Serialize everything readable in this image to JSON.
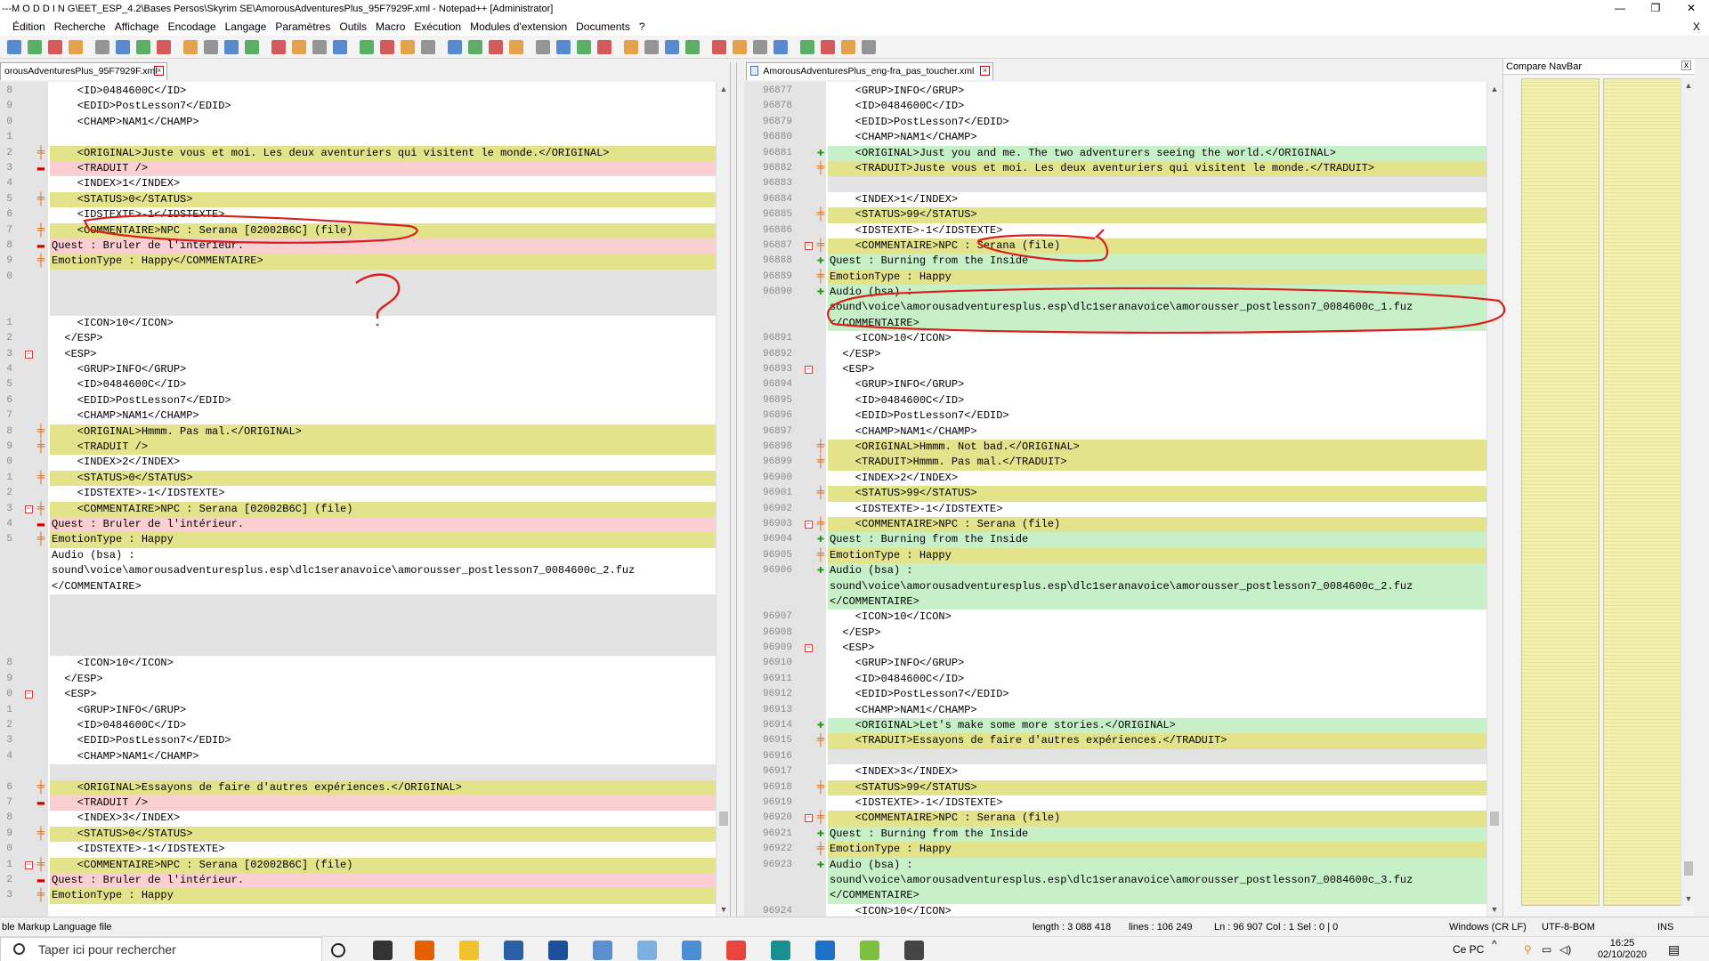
{
  "title_bar": {
    "text": "---M O D D I N G\\EET_ESP_4.2\\Bases Persos\\Skyrim SE\\AmorousAdventuresPlus_95F7929F.xml - Notepad++ [Administrator]",
    "minimize": "—",
    "maximize": "❐",
    "close": "✕"
  },
  "menu": {
    "items": [
      "Édition",
      "Recherche",
      "Affichage",
      "Encodage",
      "Langage",
      "Paramètres",
      "Outils",
      "Macro",
      "Exécution",
      "Modules d'extension",
      "Documents",
      "?"
    ],
    "close_x": "X"
  },
  "toolbar": {
    "icons": [
      "new-icon",
      "open-icon",
      "save-icon",
      "save-all-icon",
      "close-icon",
      "close-all-icon",
      "print-icon",
      "cut-icon",
      "copy-icon",
      "paste-icon",
      "undo-icon",
      "redo-icon",
      "find-icon",
      "replace-icon",
      "zoom-in-icon",
      "zoom-out-icon",
      "sync-v-icon",
      "sync-h-icon",
      "wrap-icon",
      "all-chars-icon",
      "indent-guide-icon",
      "udl-icon",
      "doc-map-icon",
      "function-list-icon",
      "folder-workspace-icon",
      "monitor-icon",
      "record-icon",
      "stop-icon",
      "play-icon",
      "play-multi-icon",
      "save-macro-icon",
      "compare-icon",
      "clear-compare-icon",
      "first-diff-icon",
      "prev-diff-icon",
      "next-diff-icon",
      "last-diff-icon",
      "nav-bar-icon",
      "spellcheck-icon",
      "spell-options-icon"
    ],
    "colors": {
      "blue": "#2b6cc4",
      "green": "#2d9b3a",
      "red": "#c93030",
      "orange": "#e08a1e",
      "gray": "#7a7a7a"
    }
  },
  "tabs": {
    "left": "orousAdventuresPlus_95F7929F.xml",
    "right": "AmorousAdventuresPlus_eng-fra_pas_toucher.xml"
  },
  "left_pane": {
    "lines": [
      {
        "n": "8",
        "cls": "",
        "mk": "",
        "f": "",
        "code": "    <ID>0484600C</ID>"
      },
      {
        "n": "9",
        "cls": "",
        "mk": "",
        "f": "",
        "code": "    <EDID>PostLesson7</EDID>"
      },
      {
        "n": "0",
        "cls": "",
        "mk": "",
        "f": "",
        "code": "    <CHAMP>NAM1</CHAMP>"
      },
      {
        "n": "1",
        "cls": "",
        "mk": "",
        "f": "",
        "code": ""
      },
      {
        "n": "2",
        "cls": "changed",
        "mk": "change",
        "f": "",
        "code": "    <ORIGINAL>Juste vous et moi. Les deux aventuriers qui visitent le monde.</ORIGINAL>"
      },
      {
        "n": "3",
        "cls": "removed",
        "mk": "remove",
        "f": "",
        "code": "    <TRADUIT />"
      },
      {
        "n": "4",
        "cls": "",
        "mk": "",
        "f": "",
        "code": "    <INDEX>1</INDEX>"
      },
      {
        "n": "5",
        "cls": "changed",
        "mk": "change",
        "f": "",
        "code": "    <STATUS>0</STATUS>"
      },
      {
        "n": "6",
        "cls": "",
        "mk": "",
        "f": "",
        "code": "    <IDSTEXTE>-1</IDSTEXTE>"
      },
      {
        "n": "7",
        "cls": "changed",
        "mk": "change",
        "f": "",
        "code": "    <COMMENTAIRE>NPC : Serana [02002B6C] (file)"
      },
      {
        "n": "8",
        "cls": "removed",
        "mk": "remove",
        "f": "",
        "code": "Quest : Bruler de l'intérieur."
      },
      {
        "n": "9",
        "cls": "changed",
        "mk": "change",
        "f": "",
        "code": "EmotionType : Happy</COMMENTAIRE>"
      },
      {
        "n": "0",
        "cls": "blank",
        "mk": "",
        "f": "",
        "code": ""
      },
      {
        "n": "",
        "cls": "blank",
        "mk": "",
        "f": "",
        "code": ""
      },
      {
        "n": "",
        "cls": "blank",
        "mk": "",
        "f": "",
        "code": ""
      },
      {
        "n": "1",
        "cls": "",
        "mk": "",
        "f": "",
        "code": "    <ICON>10</ICON>"
      },
      {
        "n": "2",
        "cls": "",
        "mk": "",
        "f": "",
        "code": "  </ESP>"
      },
      {
        "n": "3",
        "cls": "",
        "mk": "",
        "f": "fold",
        "code": "  <ESP>"
      },
      {
        "n": "4",
        "cls": "",
        "mk": "",
        "f": "",
        "code": "    <GRUP>INFO</GRUP>"
      },
      {
        "n": "5",
        "cls": "",
        "mk": "",
        "f": "",
        "code": "    <ID>0484600C</ID>"
      },
      {
        "n": "6",
        "cls": "",
        "mk": "",
        "f": "",
        "code": "    <EDID>PostLesson7</EDID>"
      },
      {
        "n": "7",
        "cls": "",
        "mk": "",
        "f": "",
        "code": "    <CHAMP>NAM1</CHAMP>"
      },
      {
        "n": "8",
        "cls": "changed",
        "mk": "change",
        "f": "",
        "code": "    <ORIGINAL>Hmmm. Pas mal.</ORIGINAL>"
      },
      {
        "n": "9",
        "cls": "changed",
        "mk": "change",
        "f": "",
        "code": "    <TRADUIT />"
      },
      {
        "n": "0",
        "cls": "",
        "mk": "",
        "f": "",
        "code": "    <INDEX>2</INDEX>"
      },
      {
        "n": "1",
        "cls": "changed",
        "mk": "change",
        "f": "",
        "code": "    <STATUS>0</STATUS>"
      },
      {
        "n": "2",
        "cls": "",
        "mk": "",
        "f": "",
        "code": "    <IDSTEXTE>-1</IDSTEXTE>"
      },
      {
        "n": "3",
        "cls": "changed",
        "mk": "change",
        "f": "fold",
        "code": "    <COMMENTAIRE>NPC : Serana [02002B6C] (file)"
      },
      {
        "n": "4",
        "cls": "removed",
        "mk": "remove",
        "f": "",
        "code": "Quest : Bruler de l'intérieur."
      },
      {
        "n": "5",
        "cls": "changed",
        "mk": "change",
        "f": "",
        "code": "EmotionType : Happy"
      },
      {
        "n": "",
        "cls": "",
        "mk": "",
        "f": "",
        "code": "Audio (bsa) :"
      },
      {
        "n": "",
        "cls": "",
        "mk": "",
        "f": "",
        "code": "sound\\voice\\amorousadventuresplus.esp\\dlc1seranavoice\\amorousser_postlesson7_0084600c_2.fuz"
      },
      {
        "n": "",
        "cls": "",
        "mk": "",
        "f": "",
        "code": "</COMMENTAIRE>"
      },
      {
        "n": "",
        "cls": "blank",
        "mk": "",
        "f": "",
        "code": ""
      },
      {
        "n": "",
        "cls": "blank",
        "mk": "",
        "f": "",
        "code": ""
      },
      {
        "n": "",
        "cls": "blank",
        "mk": "",
        "f": "",
        "code": ""
      },
      {
        "n": "",
        "cls": "blank",
        "mk": "",
        "f": "",
        "code": ""
      },
      {
        "n": "8",
        "cls": "",
        "mk": "",
        "f": "",
        "code": "    <ICON>10</ICON>"
      },
      {
        "n": "9",
        "cls": "",
        "mk": "",
        "f": "",
        "code": "  </ESP>"
      },
      {
        "n": "0",
        "cls": "",
        "mk": "",
        "f": "fold",
        "code": "  <ESP>"
      },
      {
        "n": "1",
        "cls": "",
        "mk": "",
        "f": "",
        "code": "    <GRUP>INFO</GRUP>"
      },
      {
        "n": "2",
        "cls": "",
        "mk": "",
        "f": "",
        "code": "    <ID>0484600C</ID>"
      },
      {
        "n": "3",
        "cls": "",
        "mk": "",
        "f": "",
        "code": "    <EDID>PostLesson7</EDID>"
      },
      {
        "n": "4",
        "cls": "",
        "mk": "",
        "f": "",
        "code": "    <CHAMP>NAM1</CHAMP>"
      },
      {
        "n": "",
        "cls": "blank",
        "mk": "",
        "f": "",
        "code": ""
      },
      {
        "n": "6",
        "cls": "changed",
        "mk": "change",
        "f": "",
        "code": "    <ORIGINAL>Essayons de faire d'autres expériences.</ORIGINAL>"
      },
      {
        "n": "7",
        "cls": "removed",
        "mk": "remove",
        "f": "",
        "code": "    <TRADUIT />"
      },
      {
        "n": "8",
        "cls": "",
        "mk": "",
        "f": "",
        "code": "    <INDEX>3</INDEX>"
      },
      {
        "n": "9",
        "cls": "changed",
        "mk": "change",
        "f": "",
        "code": "    <STATUS>0</STATUS>"
      },
      {
        "n": "0",
        "cls": "",
        "mk": "",
        "f": "",
        "code": "    <IDSTEXTE>-1</IDSTEXTE>"
      },
      {
        "n": "1",
        "cls": "changed",
        "mk": "change",
        "f": "fold",
        "code": "    <COMMENTAIRE>NPC : Serana [02002B6C] (file)"
      },
      {
        "n": "2",
        "cls": "removed",
        "mk": "remove",
        "f": "",
        "code": "Quest : Bruler de l'intérieur."
      },
      {
        "n": "3",
        "cls": "changed",
        "mk": "change",
        "f": "",
        "code": "EmotionType : Happy"
      }
    ]
  },
  "right_pane": {
    "lines": [
      {
        "n": "96877",
        "cls": "",
        "mk": "",
        "f": "",
        "code": "    <GRUP>INFO</GRUP>"
      },
      {
        "n": "96878",
        "cls": "",
        "mk": "",
        "f": "",
        "code": "    <ID>0484600C</ID>"
      },
      {
        "n": "96879",
        "cls": "",
        "mk": "",
        "f": "",
        "code": "    <EDID>PostLesson7</EDID>"
      },
      {
        "n": "96880",
        "cls": "",
        "mk": "",
        "f": "",
        "code": "    <CHAMP>NAM1</CHAMP>"
      },
      {
        "n": "96881",
        "cls": "added",
        "mk": "add",
        "f": "",
        "code": "    <ORIGINAL>Just you and me. The two adventurers seeing the world.</ORIGINAL>"
      },
      {
        "n": "96882",
        "cls": "changed",
        "mk": "change",
        "f": "",
        "code": "    <TRADUIT>Juste vous et moi. Les deux aventuriers qui visitent le monde.</TRADUIT>"
      },
      {
        "n": "96883",
        "cls": "blank",
        "mk": "",
        "f": "",
        "code": ""
      },
      {
        "n": "96884",
        "cls": "",
        "mk": "",
        "f": "",
        "code": "    <INDEX>1</INDEX>"
      },
      {
        "n": "96885",
        "cls": "changed",
        "mk": "change",
        "f": "",
        "code": "    <STATUS>99</STATUS>"
      },
      {
        "n": "96886",
        "cls": "",
        "mk": "",
        "f": "",
        "code": "    <IDSTEXTE>-1</IDSTEXTE>"
      },
      {
        "n": "96887",
        "cls": "changed",
        "mk": "change",
        "f": "fold",
        "code": "    <COMMENTAIRE>NPC : Serana (file)"
      },
      {
        "n": "96888",
        "cls": "added",
        "mk": "add",
        "f": "",
        "code": "Quest : Burning from the Inside"
      },
      {
        "n": "96889",
        "cls": "changed",
        "mk": "change",
        "f": "",
        "code": "EmotionType : Happy"
      },
      {
        "n": "96890",
        "cls": "added",
        "mk": "add",
        "f": "",
        "code": "Audio (bsa) :"
      },
      {
        "n": "",
        "cls": "added",
        "mk": "",
        "f": "",
        "code": "sound\\voice\\amorousadventuresplus.esp\\dlc1seranavoice\\amorousser_postlesson7_0084600c_1.fuz"
      },
      {
        "n": "",
        "cls": "added",
        "mk": "",
        "f": "",
        "code": "</COMMENTAIRE>"
      },
      {
        "n": "96891",
        "cls": "",
        "mk": "",
        "f": "",
        "code": "    <ICON>10</ICON>"
      },
      {
        "n": "96892",
        "cls": "",
        "mk": "",
        "f": "",
        "code": "  </ESP>"
      },
      {
        "n": "96893",
        "cls": "",
        "mk": "",
        "f": "fold",
        "code": "  <ESP>"
      },
      {
        "n": "96894",
        "cls": "",
        "mk": "",
        "f": "",
        "code": "    <GRUP>INFO</GRUP>"
      },
      {
        "n": "96895",
        "cls": "",
        "mk": "",
        "f": "",
        "code": "    <ID>0484600C</ID>"
      },
      {
        "n": "96896",
        "cls": "",
        "mk": "",
        "f": "",
        "code": "    <EDID>PostLesson7</EDID>"
      },
      {
        "n": "96897",
        "cls": "",
        "mk": "",
        "f": "",
        "code": "    <CHAMP>NAM1</CHAMP>"
      },
      {
        "n": "96898",
        "cls": "changed",
        "mk": "change",
        "f": "",
        "code": "    <ORIGINAL>Hmmm. Not bad.</ORIGINAL>"
      },
      {
        "n": "96899",
        "cls": "changed",
        "mk": "change",
        "f": "",
        "code": "    <TRADUIT>Hmmm. Pas mal.</TRADUIT>"
      },
      {
        "n": "96900",
        "cls": "",
        "mk": "",
        "f": "",
        "code": "    <INDEX>2</INDEX>"
      },
      {
        "n": "96901",
        "cls": "changed",
        "mk": "change",
        "f": "",
        "code": "    <STATUS>99</STATUS>"
      },
      {
        "n": "96902",
        "cls": "",
        "mk": "",
        "f": "",
        "code": "    <IDSTEXTE>-1</IDSTEXTE>"
      },
      {
        "n": "96903",
        "cls": "changed",
        "mk": "change",
        "f": "fold",
        "code": "    <COMMENTAIRE>NPC : Serana (file)"
      },
      {
        "n": "96904",
        "cls": "added",
        "mk": "add",
        "f": "",
        "code": "Quest : Burning from the Inside"
      },
      {
        "n": "96905",
        "cls": "changed",
        "mk": "change",
        "f": "",
        "code": "EmotionType : Happy"
      },
      {
        "n": "96906",
        "cls": "added",
        "mk": "add",
        "f": "",
        "code": "Audio (bsa) :"
      },
      {
        "n": "",
        "cls": "added",
        "mk": "",
        "f": "",
        "code": "sound\\voice\\amorousadventuresplus.esp\\dlc1seranavoice\\amorousser_postlesson7_0084600c_2.fuz"
      },
      {
        "n": "",
        "cls": "added",
        "mk": "",
        "f": "",
        "code": "</COMMENTAIRE>"
      },
      {
        "n": "96907",
        "cls": "",
        "mk": "",
        "f": "",
        "code": "    <ICON>10</ICON>"
      },
      {
        "n": "96908",
        "cls": "",
        "mk": "",
        "f": "",
        "code": "  </ESP>"
      },
      {
        "n": "96909",
        "cls": "",
        "mk": "",
        "f": "fold",
        "code": "  <ESP>"
      },
      {
        "n": "96910",
        "cls": "",
        "mk": "",
        "f": "",
        "code": "    <GRUP>INFO</GRUP>"
      },
      {
        "n": "96911",
        "cls": "",
        "mk": "",
        "f": "",
        "code": "    <ID>0484600C</ID>"
      },
      {
        "n": "96912",
        "cls": "",
        "mk": "",
        "f": "",
        "code": "    <EDID>PostLesson7</EDID>"
      },
      {
        "n": "96913",
        "cls": "",
        "mk": "",
        "f": "",
        "code": "    <CHAMP>NAM1</CHAMP>"
      },
      {
        "n": "96914",
        "cls": "added",
        "mk": "add",
        "f": "",
        "code": "    <ORIGINAL>Let's make some more stories.</ORIGINAL>"
      },
      {
        "n": "96915",
        "cls": "changed",
        "mk": "change",
        "f": "",
        "code": "    <TRADUIT>Essayons de faire d'autres expériences.</TRADUIT>"
      },
      {
        "n": "96916",
        "cls": "blank",
        "mk": "",
        "f": "",
        "code": ""
      },
      {
        "n": "96917",
        "cls": "",
        "mk": "",
        "f": "",
        "code": "    <INDEX>3</INDEX>"
      },
      {
        "n": "96918",
        "cls": "changed",
        "mk": "change",
        "f": "",
        "code": "    <STATUS>99</STATUS>"
      },
      {
        "n": "96919",
        "cls": "",
        "mk": "",
        "f": "",
        "code": "    <IDSTEXTE>-1</IDSTEXTE>"
      },
      {
        "n": "96920",
        "cls": "changed",
        "mk": "change",
        "f": "fold",
        "code": "    <COMMENTAIRE>NPC : Serana (file)"
      },
      {
        "n": "96921",
        "cls": "added",
        "mk": "add",
        "f": "",
        "code": "Quest : Burning from the Inside"
      },
      {
        "n": "96922",
        "cls": "changed",
        "mk": "change",
        "f": "",
        "code": "EmotionType : Happy"
      },
      {
        "n": "96923",
        "cls": "added",
        "mk": "add",
        "f": "",
        "code": "Audio (bsa) :"
      },
      {
        "n": "",
        "cls": "added",
        "mk": "",
        "f": "",
        "code": "sound\\voice\\amorousadventuresplus.esp\\dlc1seranavoice\\amorousser_postlesson7_0084600c_3.fuz"
      },
      {
        "n": "",
        "cls": "added",
        "mk": "",
        "f": "",
        "code": "</COMMENTAIRE>"
      },
      {
        "n": "96924",
        "cls": "",
        "mk": "",
        "f": "",
        "code": "    <ICON>10</ICON>"
      }
    ]
  },
  "navbar": {
    "title": "Compare NavBar",
    "close": "x"
  },
  "status_bar": {
    "file_type": "ble Markup Language file",
    "length": "length : 3 088 418",
    "lines": "lines : 106 249",
    "position": "Ln : 96 907   Col : 1   Sel : 0 | 0",
    "eol": "Windows (CR LF)",
    "encoding": "UTF-8-BOM",
    "mode": "INS"
  },
  "taskbar": {
    "search_placeholder": "Taper ici pour rechercher",
    "tray_label": "Ce PC",
    "tray_chevron": "^",
    "time": "16:25",
    "date": "02/10/2020",
    "apps": [
      {
        "name": "cortana-icon",
        "color": "#222222"
      },
      {
        "name": "task-view-icon",
        "color": "#333333"
      },
      {
        "name": "firefox-icon",
        "color": "#e66000"
      },
      {
        "name": "file-explorer-icon",
        "color": "#f2c12e"
      },
      {
        "name": "calculator-icon",
        "color": "#2a5fa8"
      },
      {
        "name": "app-m-icon",
        "color": "#1e4f9c"
      },
      {
        "name": "image-viewer-icon",
        "color": "#5a8fd0"
      },
      {
        "name": "paint-icon",
        "color": "#7bb0e0"
      },
      {
        "name": "media-icon",
        "color": "#4c8ed6"
      },
      {
        "name": "chrome-icon",
        "color": "#e8453c"
      },
      {
        "name": "edge-icon",
        "color": "#1a8f8f"
      },
      {
        "name": "game-controller-icon",
        "color": "#1d72c7"
      },
      {
        "name": "notepadpp-icon",
        "color": "#7fbf3f"
      },
      {
        "name": "pen-icon",
        "color": "#444444"
      }
    ]
  }
}
